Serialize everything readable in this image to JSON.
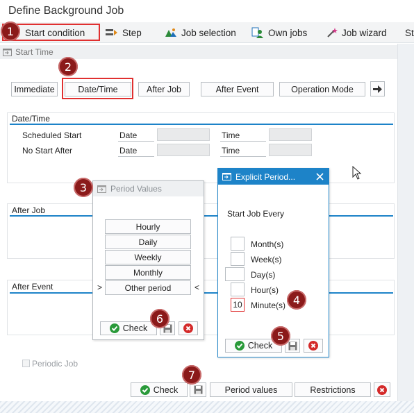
{
  "window": {
    "title": "Define Background Job"
  },
  "toolbar": {
    "start_condition": "Start condition",
    "step": "Step",
    "job_selection": "Job selection",
    "own_jobs": "Own jobs",
    "job_wizard": "Job wizard",
    "overflow": "St"
  },
  "start_time": {
    "group_title": "Start Time",
    "buttons": {
      "immediate": "Immediate",
      "date_time": "Date/Time",
      "after_job": "After Job",
      "after_event": "After Event",
      "operation_mode": "Operation Mode"
    },
    "date_time_frame": {
      "title": "Date/Time",
      "scheduled_start": "Scheduled Start",
      "no_start_after": "No Start After",
      "date_label": "Date",
      "time_label": "Time"
    },
    "after_job_title": "After Job",
    "after_event_title": "After Event",
    "periodic_job": "Periodic Job",
    "bottom": {
      "check": "Check",
      "period_values": "Period values",
      "restrictions": "Restrictions"
    }
  },
  "period_values_dialog": {
    "title": "Period Values",
    "options": [
      "Hourly",
      "Daily",
      "Weekly",
      "Monthly",
      "Other period"
    ],
    "selected_prefix": ">",
    "selected_suffix": "<",
    "check": "Check"
  },
  "explicit_period_dialog": {
    "title": "Explicit Period...",
    "subtitle": "Start Job Every",
    "units": [
      {
        "label": "Month(s)",
        "value": ""
      },
      {
        "label": "Week(s)",
        "value": ""
      },
      {
        "label": "Day(s)",
        "value": ""
      },
      {
        "label": "Hour(s)",
        "value": ""
      },
      {
        "label": "Minute(s)",
        "value": "10"
      }
    ],
    "check": "Check"
  },
  "markers": [
    "1",
    "2",
    "3",
    "4",
    "5",
    "6",
    "7"
  ],
  "colors": {
    "accent_blue": "#1d83c8",
    "marker_red": "#8b1a1a",
    "highlight_red": "#e03030",
    "check_green": "#2a9a3a",
    "cancel_red": "#d42a2a"
  }
}
